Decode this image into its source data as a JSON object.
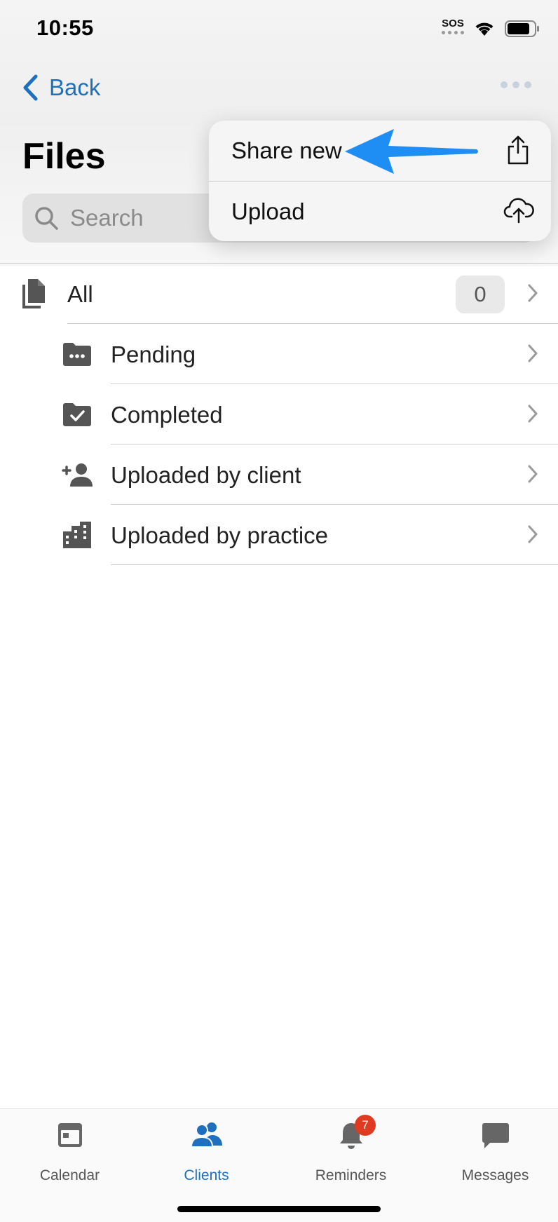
{
  "status": {
    "time": "10:55",
    "sos": "SOS"
  },
  "nav": {
    "back_label": "Back",
    "title": "Files"
  },
  "search": {
    "placeholder": "Search"
  },
  "menu": {
    "items": [
      {
        "label": "Share new",
        "icon": "share-icon"
      },
      {
        "label": "Upload",
        "icon": "cloud-upload-icon"
      }
    ]
  },
  "list": {
    "all": {
      "label": "All",
      "count": "0",
      "icon": "files-icon"
    },
    "items": [
      {
        "label": "Pending",
        "icon": "folder-pending-icon"
      },
      {
        "label": "Completed",
        "icon": "folder-check-icon"
      },
      {
        "label": "Uploaded by client",
        "icon": "person-add-icon"
      },
      {
        "label": "Uploaded by practice",
        "icon": "building-icon"
      }
    ]
  },
  "tabs": [
    {
      "label": "Calendar",
      "icon": "calendar-icon",
      "active": false
    },
    {
      "label": "Clients",
      "icon": "people-icon",
      "active": true
    },
    {
      "label": "Reminders",
      "icon": "bell-icon",
      "active": false,
      "badge": "7"
    },
    {
      "label": "Messages",
      "icon": "chat-icon",
      "active": false
    }
  ],
  "colors": {
    "accent": "#1f6fbf",
    "arrow": "#1e8ef5",
    "badge": "#e03a20"
  }
}
